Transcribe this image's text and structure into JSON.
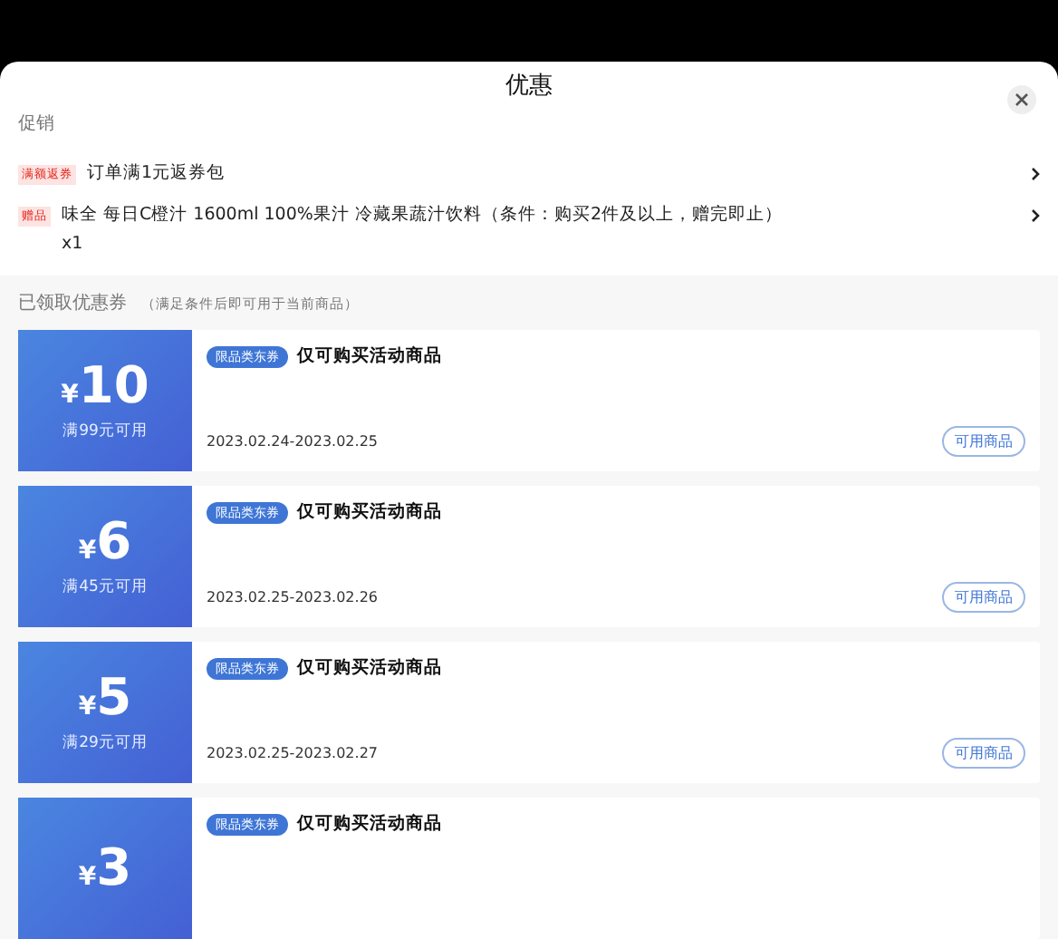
{
  "sheet": {
    "title": "优惠"
  },
  "promotions": {
    "heading": "促销",
    "items": [
      {
        "tag": "满额返券",
        "text": "订单满1元返券包"
      },
      {
        "tag": "赠品",
        "text": "味全 每日C橙汁 1600ml 100%果汁 冷藏果蔬汁饮料（条件：购买2件及以上，赠完即止）",
        "note": "x1"
      }
    ]
  },
  "coupons": {
    "heading": "已领取优惠券",
    "hint": "（满足条件后即可用于当前商品）",
    "items": [
      {
        "currency": "¥",
        "amount": "10",
        "condition": "满99元可用",
        "tag": "限品类东券",
        "title": "仅可购买活动商品",
        "validity": "2023.02.24-2023.02.25",
        "button": "可用商品"
      },
      {
        "currency": "¥",
        "amount": "6",
        "condition": "满45元可用",
        "tag": "限品类东券",
        "title": "仅可购买活动商品",
        "validity": "2023.02.25-2023.02.26",
        "button": "可用商品"
      },
      {
        "currency": "¥",
        "amount": "5",
        "condition": "满29元可用",
        "tag": "限品类东券",
        "title": "仅可购买活动商品",
        "validity": "2023.02.25-2023.02.27",
        "button": "可用商品"
      },
      {
        "currency": "¥",
        "amount": "3",
        "tag": "限品类东券",
        "title": "仅可购买活动商品"
      }
    ]
  }
}
